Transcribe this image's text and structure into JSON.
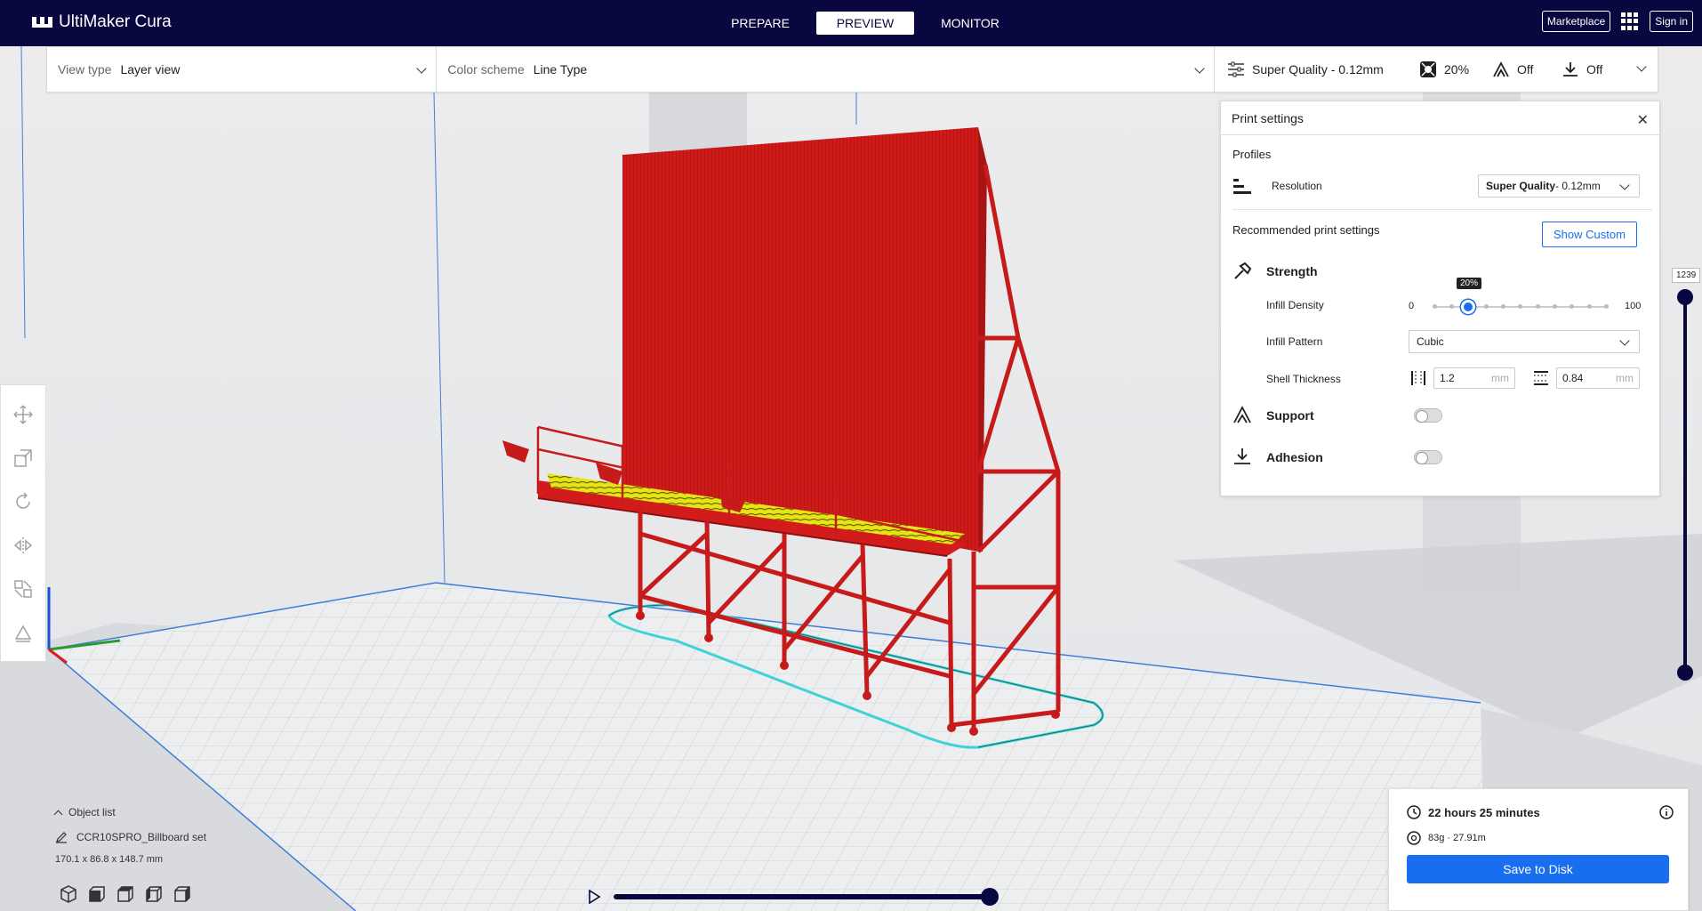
{
  "app": {
    "name": "UltiMaker Cura"
  },
  "stages": [
    {
      "label": "PREPARE",
      "active": false
    },
    {
      "label": "PREVIEW",
      "active": true
    },
    {
      "label": "MONITOR",
      "active": false
    }
  ],
  "header": {
    "marketplace_label": "Marketplace",
    "signin_label": "Sign in"
  },
  "toolbar": {
    "view_type_label": "View type",
    "view_type_value": "Layer view",
    "color_scheme_label": "Color scheme",
    "color_scheme_value": "Line Type",
    "profile": "Super Quality - 0.12mm",
    "infill": "20%",
    "support": "Off",
    "adhesion": "Off"
  },
  "print_settings": {
    "title": "Print settings",
    "profiles_label": "Profiles",
    "resolution_label": "Resolution",
    "resolution_value_bold": "Super Quality",
    "resolution_value_rest": " - 0.12mm",
    "recommended_label": "Recommended print settings",
    "show_custom_label": "Show Custom",
    "strength_label": "Strength",
    "infill_density_label": "Infill Density",
    "infill_min": "0",
    "infill_max": "100",
    "infill_tooltip": "20%",
    "infill_density_value": 20,
    "infill_pattern_label": "Infill Pattern",
    "infill_pattern_value": "Cubic",
    "shell_thickness_label": "Shell Thickness",
    "wall_thickness": "1.2",
    "top_bottom_thickness": "0.84",
    "unit": "mm",
    "support_label": "Support",
    "adhesion_label": "Adhesion",
    "support_enabled": false,
    "adhesion_enabled": false
  },
  "layer_slider": {
    "value": "1239"
  },
  "object_list": {
    "toggle_label": "Object list",
    "object_name": "CCR10SPRO_Billboard set",
    "dimensions": "170.1 x 86.8 x 148.7 mm"
  },
  "output": {
    "print_time": "22 hours 25 minutes",
    "material": "83g · 27.91m",
    "save_label": "Save to Disk"
  },
  "colors": {
    "header_bg": "#08073f",
    "accent_blue": "#196ef0",
    "model_red": "#d61e1e",
    "infill_yellow": "#e8e317",
    "skirt_cyan": "#3fd3d6"
  }
}
